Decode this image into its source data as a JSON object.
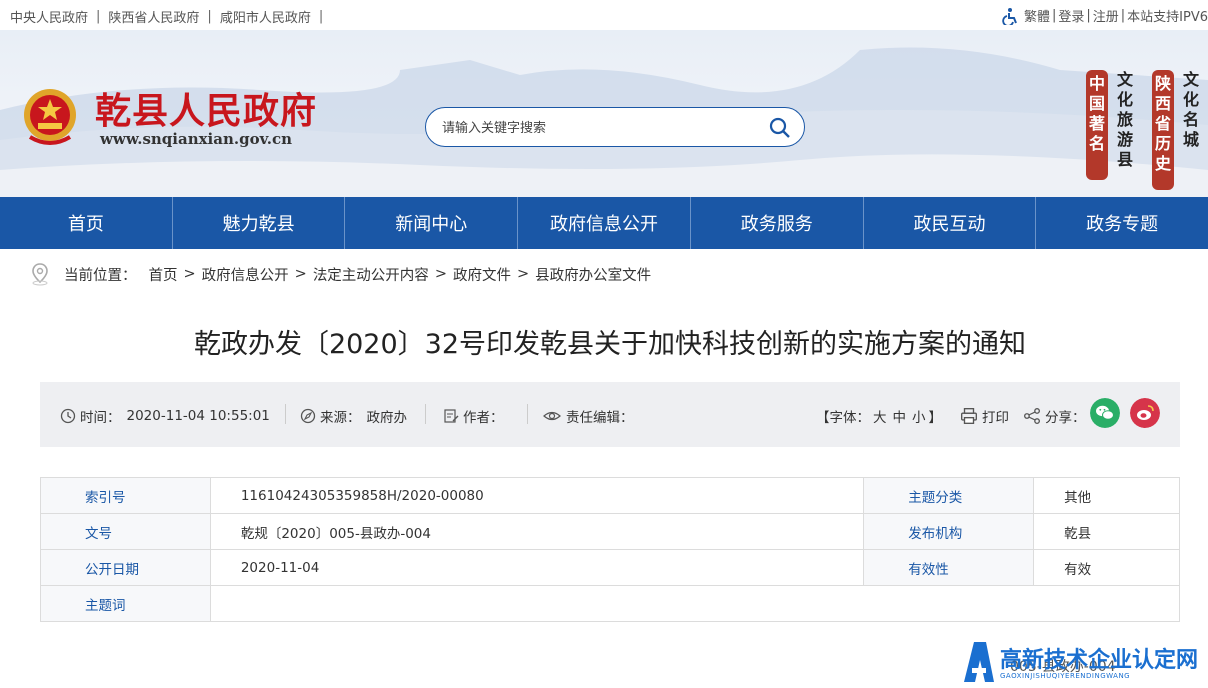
{
  "topbar": {
    "links": [
      "中央人民政府",
      "陕西省人民政府",
      "咸阳市人民政府"
    ],
    "separator": "|",
    "traditional": "繁體",
    "login": "登录",
    "register": "注册",
    "ipv6": "本站支持IPV6"
  },
  "header": {
    "site_title": "乾县人民政府",
    "site_url": "www.snqianxian.gov.cn",
    "search_placeholder": "请输入关键字搜索",
    "calligraphy": [
      "文化名城",
      "陕西省历史",
      "文化旅游县",
      "中国著名"
    ]
  },
  "nav": {
    "items": [
      "首页",
      "魅力乾县",
      "新闻中心",
      "政府信息公开",
      "政务服务",
      "政民互动",
      "政务专题"
    ]
  },
  "breadcrumb": {
    "label": "当前位置：",
    "items": [
      "首页",
      "政府信息公开",
      "法定主动公开内容",
      "政府文件",
      "县政府办公室文件"
    ],
    "arrow": ">"
  },
  "article": {
    "title": "乾政办发〔2020〕32号印发乾县关于加快科技创新的实施方案的通知"
  },
  "meta": {
    "time_label": "时间：",
    "time_value": "2020-11-04 10:55:01",
    "source_label": "来源：",
    "source_value": "政府办",
    "author_label": "作者：",
    "editor_label": "责任编辑：",
    "font_label": "【字体：",
    "font_large": "大",
    "font_medium": "中",
    "font_small": "小",
    "font_close": "】",
    "print_label": "打印",
    "share_label": "分享："
  },
  "info_table": {
    "rows": [
      {
        "k1": "索引号",
        "v1": "11610424305359858H/2020-00080",
        "k2": "主题分类",
        "v2": "其他"
      },
      {
        "k1": "文号",
        "v1": "乾规〔2020〕005-县政办-004",
        "k2": "发布机构",
        "v2": "乾县"
      },
      {
        "k1": "公开日期",
        "v1": "2020-11-04",
        "k2": "有效性",
        "v2": "有效"
      },
      {
        "k1": "主题词",
        "v1": "",
        "k2": "",
        "v2": ""
      }
    ]
  },
  "below_text": "005-县政办-004",
  "watermark": {
    "text": "高新技术企业认定网",
    "sub": "GAOXINJISHUQIYERENDINGWANG"
  },
  "colors": {
    "nav_bg": "#1a57a6",
    "title_red": "#c8161d",
    "link_blue": "#1a57a6",
    "wechat": "#2aae67",
    "weibo": "#d6344a"
  }
}
